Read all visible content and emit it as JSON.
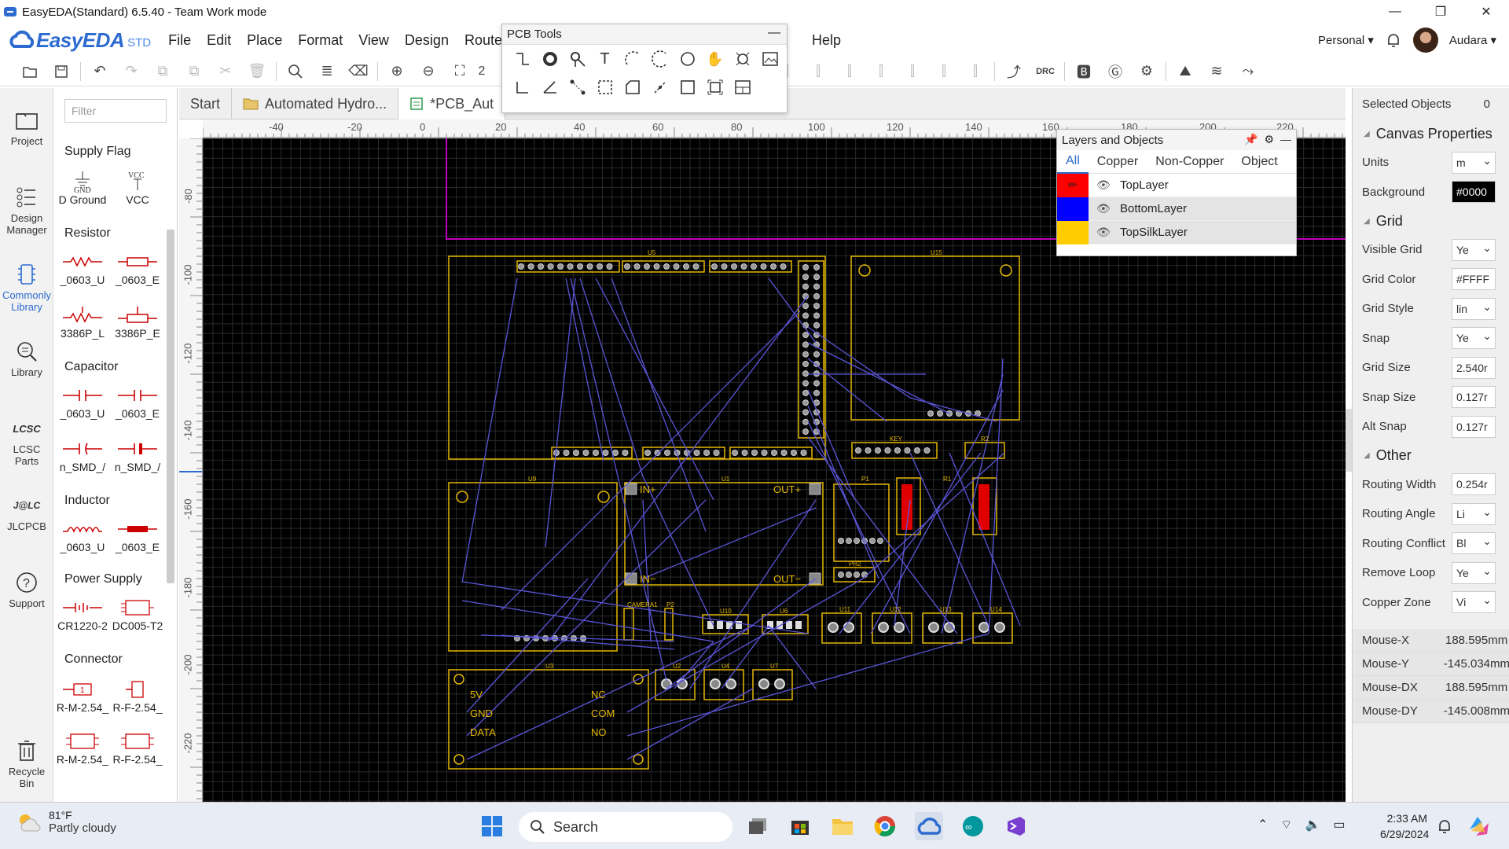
{
  "window": {
    "title": "EasyEDA(Standard) 6.5.40 - Team Work mode",
    "controls": [
      "—",
      "❐",
      "✕"
    ]
  },
  "menubar": {
    "logo": "EasyEDA",
    "logo_sub": "STD",
    "items": [
      "File",
      "Edit",
      "Place",
      "Format",
      "View",
      "Design",
      "Route",
      "Help"
    ],
    "personal": "Personal",
    "user": "Audara"
  },
  "toolbar": {
    "zoom_label": "2"
  },
  "leftrail": {
    "items": [
      {
        "label": "Project",
        "icon": "folder-icon"
      },
      {
        "label": "Design Manager",
        "icon": "design-manager-icon"
      },
      {
        "label": "Commonly Library",
        "icon": "common-library-icon"
      },
      {
        "label": "Library",
        "icon": "library-search-icon"
      },
      {
        "label": "LCSC Parts",
        "icon": "lcsc-icon"
      },
      {
        "label": "JLCPCB",
        "icon": "jlcpcb-icon"
      },
      {
        "label": "Support",
        "icon": "help-icon"
      },
      {
        "label": "Recycle Bin",
        "icon": "trash-icon"
      }
    ]
  },
  "library": {
    "filter_placeholder": "Filter",
    "categories": [
      {
        "name": "Supply Flag",
        "parts": [
          "D Ground",
          "VCC"
        ],
        "symbols": [
          "GND",
          "VCC"
        ]
      },
      {
        "name": "Resistor",
        "parts": [
          "_0603_U",
          "_0603_E",
          "3386P_L",
          "3386P_E"
        ]
      },
      {
        "name": "Capacitor",
        "parts": [
          "_0603_U",
          "_0603_E",
          "n_SMD_/",
          "n_SMD_/"
        ]
      },
      {
        "name": "Inductor",
        "parts": [
          "_0603_U",
          "_0603_E"
        ]
      },
      {
        "name": "Power Supply",
        "parts": [
          "CR1220-2",
          "DC005-T2"
        ]
      },
      {
        "name": "Connector",
        "parts": [
          "R-M-2.54_",
          "R-F-2.54_",
          "R-M-2.54_",
          "R-F-2.54_"
        ]
      }
    ]
  },
  "tabs": [
    {
      "label": "Start"
    },
    {
      "label": "Automated Hydro..."
    },
    {
      "label": "*PCB_Aut"
    }
  ],
  "rulers": {
    "top": [
      "-40",
      "-20",
      "0",
      "20",
      "40",
      "60",
      "80",
      "100",
      "120",
      "140",
      "160",
      "180",
      "200",
      "220"
    ],
    "left": [
      "-80",
      "-100",
      "-120",
      "-140",
      "-160",
      "-180",
      "-200",
      "-220"
    ]
  },
  "pcb_tools": {
    "title": "PCB Tools"
  },
  "layers_panel": {
    "title": "Layers and Objects",
    "tabs": [
      "All",
      "Copper",
      "Non-Copper",
      "Object"
    ],
    "layers": [
      {
        "name": "TopLayer",
        "color": "#ff0000"
      },
      {
        "name": "BottomLayer",
        "color": "#0000ff"
      },
      {
        "name": "TopSilkLayer",
        "color": "#ffcc00"
      }
    ]
  },
  "canvas_labels": {
    "components": [
      "U5",
      "U15",
      "U9",
      "U1",
      "U3",
      "P1",
      "R1",
      "R2",
      "KEY",
      "CAMERA1",
      "P2",
      "U10",
      "U6",
      "U11",
      "U12",
      "U13",
      "U14",
      "U2",
      "U4",
      "U7",
      "PH2"
    ],
    "module_pins": [
      "IN+",
      "IN−",
      "OUT+",
      "OUT−",
      "5V",
      "GND",
      "DATA",
      "NC",
      "COM",
      "NO"
    ]
  },
  "right_panel": {
    "selected_label": "Selected Objects",
    "selected_count": "0",
    "canvas_title": "Canvas Properties",
    "units_label": "Units",
    "units": "m",
    "bg_label": "Background",
    "bg": "#0000",
    "grid_title": "Grid",
    "visible_grid_label": "Visible Grid",
    "visible_grid": "Ye",
    "grid_color_label": "Grid Color",
    "grid_color": "#FFFF",
    "grid_style_label": "Grid Style",
    "grid_style": "lin",
    "snap_label": "Snap",
    "snap": "Ye",
    "grid_size_label": "Grid Size",
    "grid_size": "2.540r",
    "snap_size_label": "Snap Size",
    "snap_size": "0.127r",
    "alt_snap_label": "Alt Snap",
    "alt_snap": "0.127r",
    "other_title": "Other",
    "routing_width_label": "Routing Width",
    "routing_width": "0.254r",
    "routing_angle_label": "Routing Angle",
    "routing_angle": "Li",
    "routing_conflict_label": "Routing Conflict",
    "routing_conflict": "Bl",
    "remove_loop_label": "Remove Loop",
    "remove_loop": "Ye",
    "copper_zone_label": "Copper Zone",
    "copper_zone": "Vi",
    "mouse": [
      {
        "label": "Mouse-X",
        "value": "188.595mm"
      },
      {
        "label": "Mouse-Y",
        "value": "-145.034mm"
      },
      {
        "label": "Mouse-DX",
        "value": "188.595mm"
      },
      {
        "label": "Mouse-DY",
        "value": "-145.008mm"
      }
    ]
  },
  "taskbar": {
    "temp": "81°F",
    "weather": "Partly cloudy",
    "search_label": "Search",
    "time": "2:33 AM",
    "date": "6/29/2024"
  }
}
